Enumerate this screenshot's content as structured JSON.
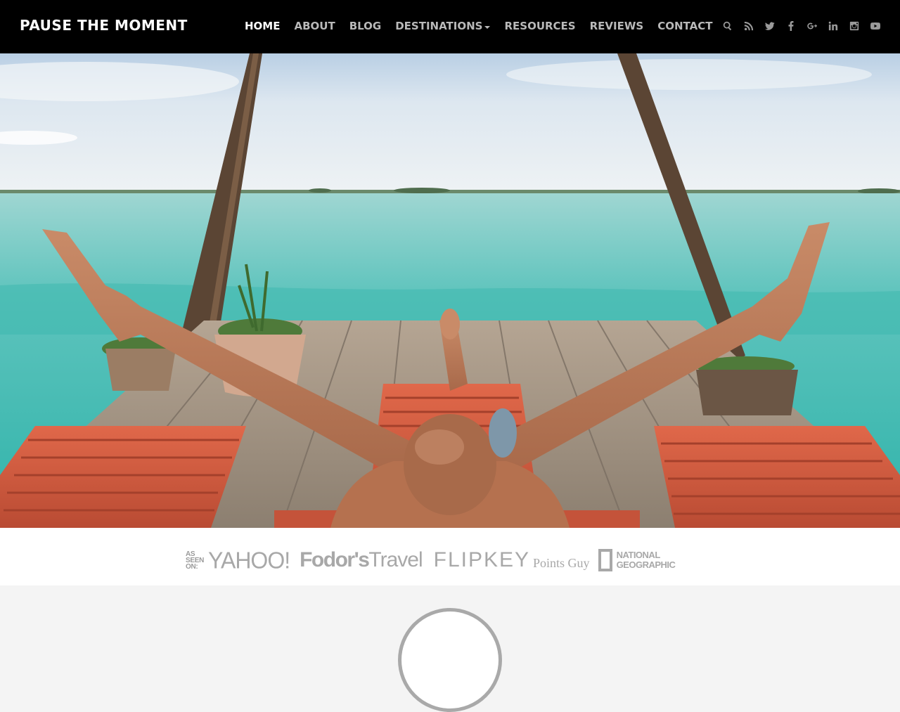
{
  "brand": {
    "name": "PAUSE THE MOMENT"
  },
  "nav": {
    "items": [
      {
        "label": "HOME",
        "active": true
      },
      {
        "label": "ABOUT",
        "active": false
      },
      {
        "label": "BLOG",
        "active": false
      },
      {
        "label": "DESTINATIONS",
        "active": false,
        "has_dropdown": true
      },
      {
        "label": "RESOURCES",
        "active": false
      },
      {
        "label": "REVIEWS",
        "active": false
      },
      {
        "label": "CONTACT",
        "active": false
      }
    ]
  },
  "social_icons": [
    "search-icon",
    "rss-icon",
    "twitter-icon",
    "facebook-icon",
    "google-plus-icon",
    "linkedin-icon",
    "instagram-icon",
    "youtube-icon"
  ],
  "press": {
    "intro": "AS SEEN ON:",
    "logos": {
      "yahoo": "YAHOO!",
      "fodors_bold": "Fodor's",
      "fodors_thin": "Travel",
      "flipkey": "FLIPKEY",
      "pointsguy": "Points Guy",
      "natgeo_line1": "NATIONAL",
      "natgeo_line2": "GEOGRAPHIC"
    }
  },
  "colors": {
    "topbar": "#000000",
    "nav_active": "#ffffff",
    "nav_inactive": "#b9b9b9",
    "logo_gray": "#a8a8a8",
    "lower_bg": "#f4f4f4"
  }
}
